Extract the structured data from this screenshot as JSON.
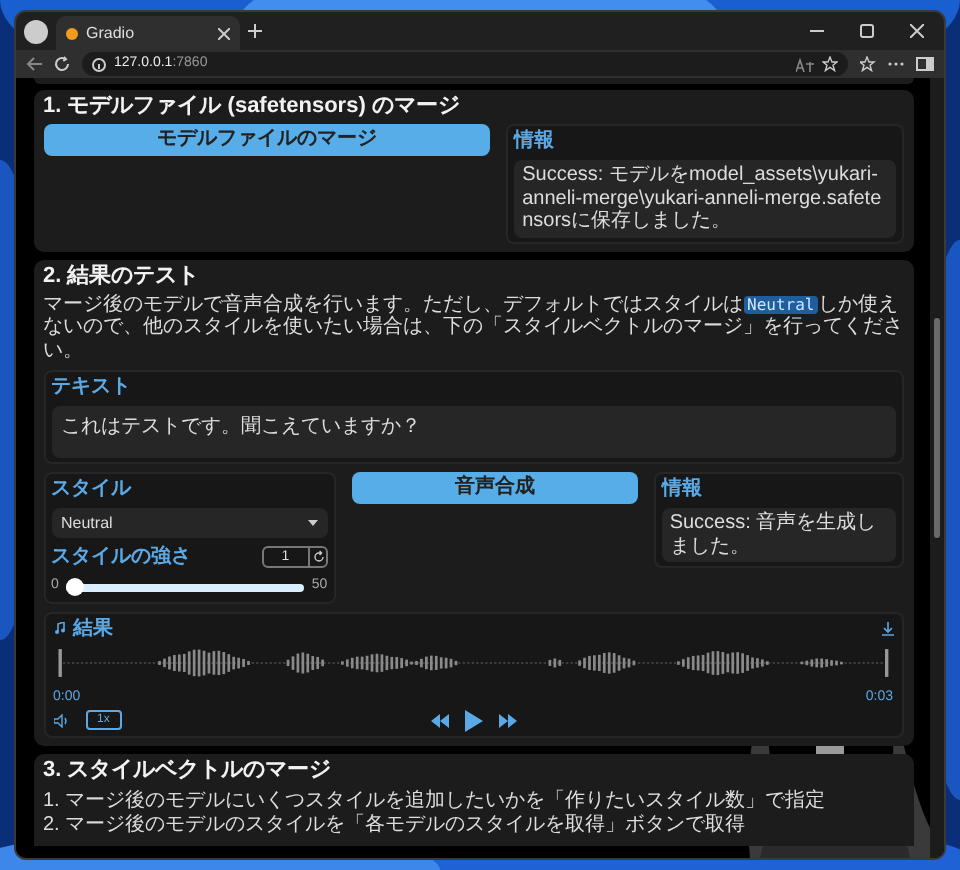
{
  "browser": {
    "tab_title": "Gradio",
    "address_host": "127.0.0.1",
    "address_port": ":7860"
  },
  "merge_section": {
    "title": "1. モデルファイル (safetensors) のマージ",
    "button": "モデルファイルのマージ",
    "info_label": "情報",
    "info_text": "Success: モデルをmodel_assets\\yukari-anneli-merge\\yukari-anneli-merge.safetensorsに保存しました。"
  },
  "test_section": {
    "title": "2. 結果のテスト",
    "description_before": "マージ後のモデルで音声合成を行います。ただし、デフォルトではスタイルは",
    "description_code": "Neutral",
    "description_after": "しか使えないので、他のスタイルを使いたい場合は、下の「スタイルベクトルのマージ」を行ってください。",
    "text_label": "テキスト",
    "text_value": "これはテストです。聞こえていますか？",
    "style_label": "スタイル",
    "style_value": "Neutral",
    "strength_label": "スタイルの強さ",
    "strength_value": "1",
    "strength_min": "0",
    "strength_max": "50",
    "strength": {
      "level": 0.03
    },
    "synth_button": "音声合成",
    "info_label": "情報",
    "info_text": "Success: 音声を生成しました。",
    "audio": {
      "label": "結果",
      "time_start": "0:00",
      "time_end": "0:03",
      "speed": "1x"
    }
  },
  "vector_section": {
    "title": "3. スタイルベクトルのマージ",
    "steps": [
      "1. マージ後のモデルにいくつスタイルを追加したいかを「作りたいスタイル数」で指定",
      "2. マージ後のモデルのスタイルを「各モデルのスタイルを取得」ボタンで取得"
    ]
  }
}
